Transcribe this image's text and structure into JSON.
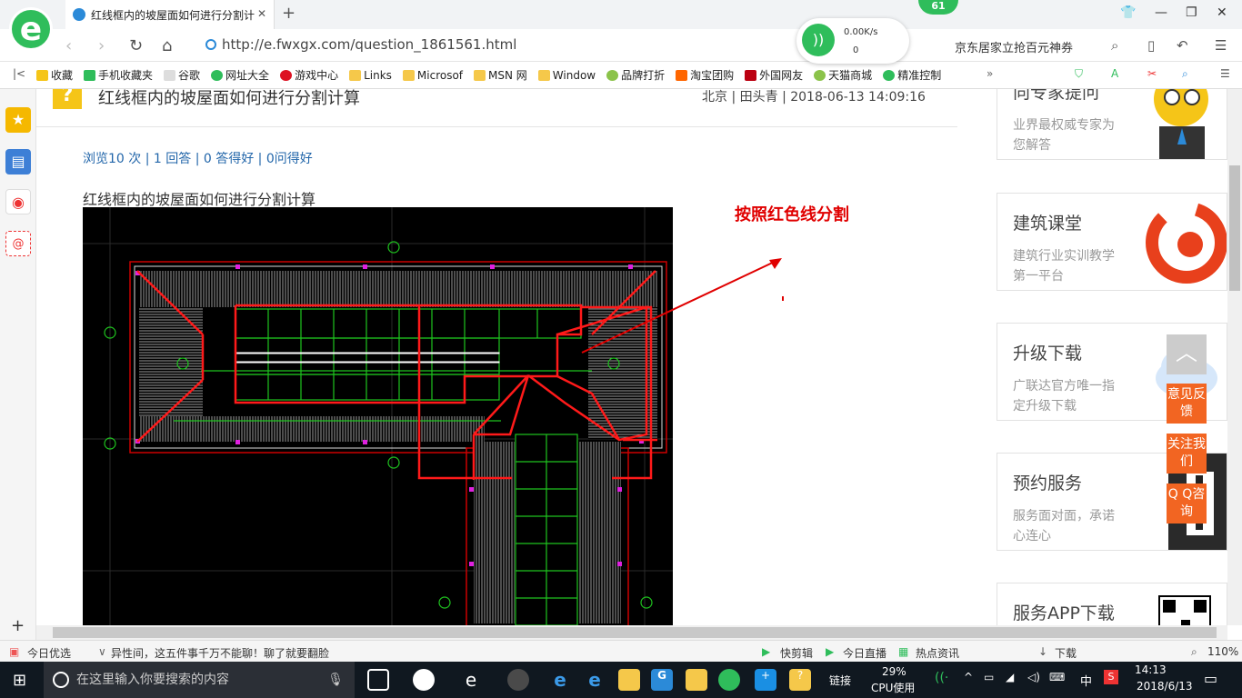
{
  "browser": {
    "tab_title": "红线框内的坡屋面如何进行分割计",
    "url": "http://e.fwxgx.com/question_1861561.html",
    "net_speed": "0.00K/s",
    "net_count": "0",
    "badge": "61",
    "promo": "京东居家立抢百元神券",
    "bookmarks": [
      "收藏",
      "手机收藏夹",
      "谷歌",
      "网址大全",
      "游戏中心",
      "Links",
      "Microsof",
      "MSN 网",
      "Window",
      "品牌打折",
      "淘宝团购",
      "外国网友",
      "天猫商城",
      "精准控制"
    ]
  },
  "question": {
    "title": "红线框内的坡屋面如何进行分割计算",
    "meta": "北京 | 田头青 | 2018-06-13 14:09:16",
    "stats": "浏览10 次 | 1 回答 | 0 答得好 | 0问得好",
    "body": "红线框内的坡屋面如何进行分割计算",
    "annotation": "按照红色线分割"
  },
  "cards": [
    {
      "title": "向专家提问",
      "sub": "业界最权威专家为您解答",
      "color": "#f5c518"
    },
    {
      "title": "建筑课堂",
      "sub": "建筑行业实训教学第一平台",
      "color": "#e8401c"
    },
    {
      "title": "升级下载",
      "sub": "广联达官方唯一指定升级下载",
      "color": "#4a90d9"
    },
    {
      "title": "预约服务",
      "sub": "服务面对面，承诺心连心",
      "color": "#555555"
    },
    {
      "title": "服务APP下载",
      "sub": "",
      "color": "#000000"
    }
  ],
  "float_buttons": [
    "意见反馈",
    "关注我们",
    "Q Q咨询"
  ],
  "status": {
    "today": "今日优选",
    "headline": "异性间，这五件事千万不能聊！聊了就要翻脸",
    "items": [
      "快剪辑",
      "今日直播",
      "热点资讯",
      "下载"
    ],
    "zoom": "110%"
  },
  "taskbar": {
    "search_placeholder": "在这里输入你要搜索的内容",
    "link": "链接",
    "cpu": "29%",
    "cpu_label": "CPU使用",
    "ime": "中",
    "time": "14:13",
    "date": "2018/6/13"
  }
}
